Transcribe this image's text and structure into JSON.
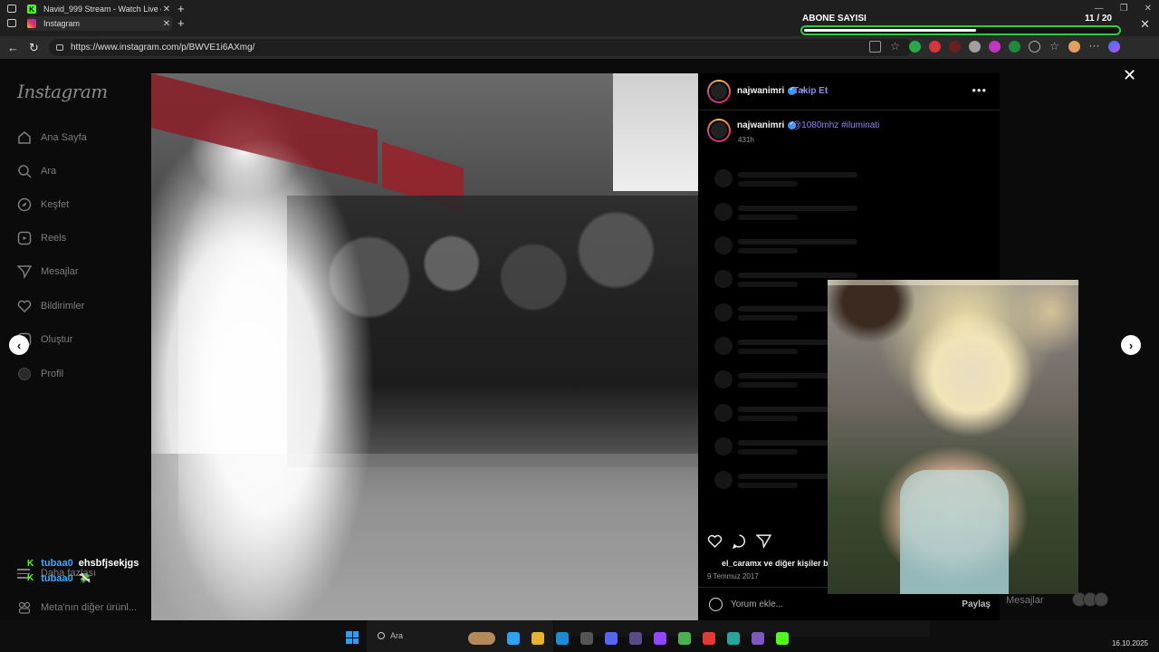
{
  "browser": {
    "tabs": [
      {
        "title": "Navid_999 Stream - Watch Live o",
        "favicon_color": "#53fc18",
        "favicon_glyph": "K"
      },
      {
        "title": "Instagram",
        "favicon_color": "#e1306c",
        "favicon_glyph": ""
      }
    ],
    "url": "https://www.instagram.com/p/BWVE1i6AXmg/"
  },
  "stream_overlay": {
    "abone_label": "ABONE SAYISI",
    "abone_count": "11  / 20",
    "progress_fraction": 0.55,
    "chat": [
      {
        "user": "tubaa0",
        "message": "ehsbfjsekjgs"
      },
      {
        "user": "tubaa0",
        "message": "💸"
      }
    ]
  },
  "instagram": {
    "logo": "Instagram",
    "nav": [
      {
        "label": "Ana Sayfa",
        "icon": "home-icon"
      },
      {
        "label": "Ara",
        "icon": "search-icon"
      },
      {
        "label": "Keşfet",
        "icon": "compass-icon"
      },
      {
        "label": "Reels",
        "icon": "reels-icon"
      },
      {
        "label": "Mesajlar",
        "icon": "send-icon"
      },
      {
        "label": "Bildirimler",
        "icon": "heart-icon"
      },
      {
        "label": "Oluştur",
        "icon": "plus-icon"
      },
      {
        "label": "Profil",
        "icon": "avatar-icon"
      }
    ],
    "more_label": "Daha fazlası",
    "meta_label": "Meta'nın diğer ürünl...",
    "post": {
      "author": "najwanimri",
      "follow_label": "Takip Et",
      "follow_separator": "•",
      "caption_author": "najwanimri",
      "caption_text": "@1080mhz #iluminati",
      "time_ago": "431h",
      "likes_text": "el_caramx ve diğer kişiler be",
      "date": "9 Temmuz 2017",
      "comment_placeholder": "Yorum ekle...",
      "share_label": "Paylaş"
    },
    "messages_ghost": "Mesajlar"
  },
  "taskbar": {
    "search_placeholder": "Ara",
    "date": "16.10.2025"
  },
  "colors": {
    "accent_link": "#8c84ff",
    "kick_green": "#53fc18",
    "chat_user": "#3fa7ff",
    "progress_border": "#2ecc40"
  }
}
